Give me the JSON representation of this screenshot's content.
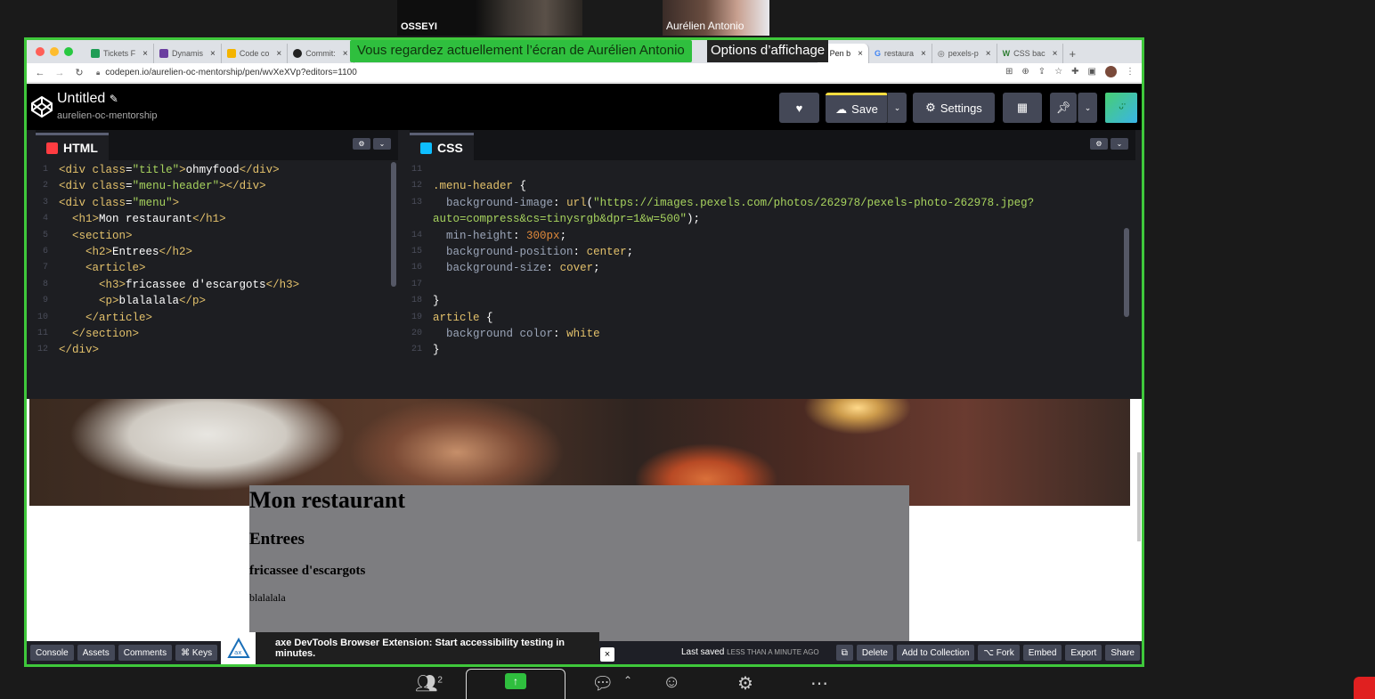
{
  "zoom": {
    "participants": [
      {
        "name": "OSSEYI"
      },
      {
        "name": "Aurélien Antonio"
      }
    ],
    "share_banner": "Vous regardez actuellement l’écran de Aurélien Antonio",
    "options_label": "Options d’affichage",
    "participants_count": "2"
  },
  "browser": {
    "tabs": [
      {
        "label": "Tickets F",
        "color": "#1f9d55"
      },
      {
        "label": "Dynamis",
        "color": "#6b3fa0"
      },
      {
        "label": "Code co",
        "color": "#f4b400"
      },
      {
        "label": "Commit:",
        "color": "#222222"
      },
      {
        "label": "A Pen b",
        "color": "#222222",
        "active": true
      },
      {
        "label": "restaura",
        "color": "#4285f4"
      },
      {
        "label": "pexels-p",
        "color": "#555555"
      },
      {
        "label": "CSS bac",
        "color": "#2e7d32"
      }
    ],
    "url": "codepen.io/aurelien-oc-mentorship/pen/wvXeXVp?editors=1100"
  },
  "codepen": {
    "title": "Untitled",
    "user": "aurelien-oc-mentorship",
    "save_label": "Save",
    "settings_label": "Settings"
  },
  "html_editor": {
    "label": "HTML",
    "lines": [
      {
        "n": "1",
        "html": "<span class='tg'>&lt;div</span> <span class='at'>class</span>=<span class='st'>\"title\"</span><span class='tg'>&gt;</span><span class='tx'>ohmyfood</span><span class='tg'>&lt;/div&gt;</span>"
      },
      {
        "n": "2",
        "html": "<span class='tg'>&lt;div</span> <span class='at'>class</span>=<span class='st'>\"menu-header\"</span><span class='tg'>&gt;&lt;/div&gt;</span>"
      },
      {
        "n": "3",
        "html": "<span class='tg'>&lt;div</span> <span class='at'>class</span>=<span class='st'>\"menu\"</span><span class='tg'>&gt;</span>"
      },
      {
        "n": "4",
        "html": "  <span class='tg'>&lt;h1&gt;</span><span class='tx'>Mon restaurant</span><span class='tg'>&lt;/h1&gt;</span>"
      },
      {
        "n": "5",
        "html": "  <span class='tg'>&lt;section&gt;</span>"
      },
      {
        "n": "6",
        "html": "    <span class='tg'>&lt;h2&gt;</span><span class='tx'>Entrees</span><span class='tg'>&lt;/h2&gt;</span>"
      },
      {
        "n": "7",
        "html": "    <span class='tg'>&lt;article&gt;</span>"
      },
      {
        "n": "8",
        "html": "      <span class='tg'>&lt;h3&gt;</span><span class='tx'>fricassee d'escargots</span><span class='tg'>&lt;/h3&gt;</span>"
      },
      {
        "n": "9",
        "html": "      <span class='tg'>&lt;p&gt;</span><span class='tx'>blalalala</span><span class='tg'>&lt;/p&gt;</span>"
      },
      {
        "n": "10",
        "html": "    <span class='tg'>&lt;/article&gt;</span>"
      },
      {
        "n": "11",
        "html": "  <span class='tg'>&lt;/section&gt;</span>"
      },
      {
        "n": "12",
        "html": "<span class='tg'>&lt;/div&gt;</span>"
      }
    ]
  },
  "css_editor": {
    "label": "CSS",
    "lines": [
      {
        "n": "11",
        "html": ""
      },
      {
        "n": "12",
        "html": "<span class='sel'>.menu-header</span> <span class='tx'>{</span>"
      },
      {
        "n": "13",
        "html": "  <span class='prop'>background-image</span><span class='tx'>: </span><span class='val'>url</span><span class='tx'>(</span><span class='str'>\"https://images.pexels.com/photos/262978/pexels-photo-262978.jpeg?</span>"
      },
      {
        "n": "",
        "html": "<span class='str'>auto=compress&amp;cs=tinysrgb&amp;dpr=1&amp;w=500\"</span><span class='tx'>);</span>"
      },
      {
        "n": "14",
        "html": "  <span class='prop'>min-height</span><span class='tx'>: </span><span class='numv'>300px</span><span class='tx'>;</span>"
      },
      {
        "n": "15",
        "html": "  <span class='prop'>background-position</span><span class='tx'>: </span><span class='val'>center</span><span class='tx'>;</span>"
      },
      {
        "n": "16",
        "html": "  <span class='prop'>background-size</span><span class='tx'>: </span><span class='val'>cover</span><span class='tx'>;</span>"
      },
      {
        "n": "17",
        "html": ""
      },
      {
        "n": "18",
        "html": "<span class='tx'>}</span>"
      },
      {
        "n": "19",
        "html": "<span class='sel'>article</span> <span class='tx'>{</span>"
      },
      {
        "n": "20",
        "html": "  <span class='prop'>background color</span><span class='tx'>: </span><span class='val'>white</span>"
      },
      {
        "n": "21",
        "html": "<span class='tx'>}</span>"
      }
    ]
  },
  "preview": {
    "h1": "Mon restaurant",
    "h2": "Entrees",
    "h3": "fricassee d'escargots",
    "p": "blalalala"
  },
  "footer": {
    "left_buttons": [
      "Console",
      "Assets",
      "Comments",
      "⌘ Keys"
    ],
    "axe_text": "axe DevTools Browser Extension: Start accessibility testing in minutes.",
    "last_saved": "Last saved",
    "last_saved_when": "LESS THAN A MINUTE AGO",
    "right_buttons": [
      "Delete",
      "Add to Collection",
      "⌥ Fork",
      "Embed",
      "Export",
      "Share"
    ]
  }
}
